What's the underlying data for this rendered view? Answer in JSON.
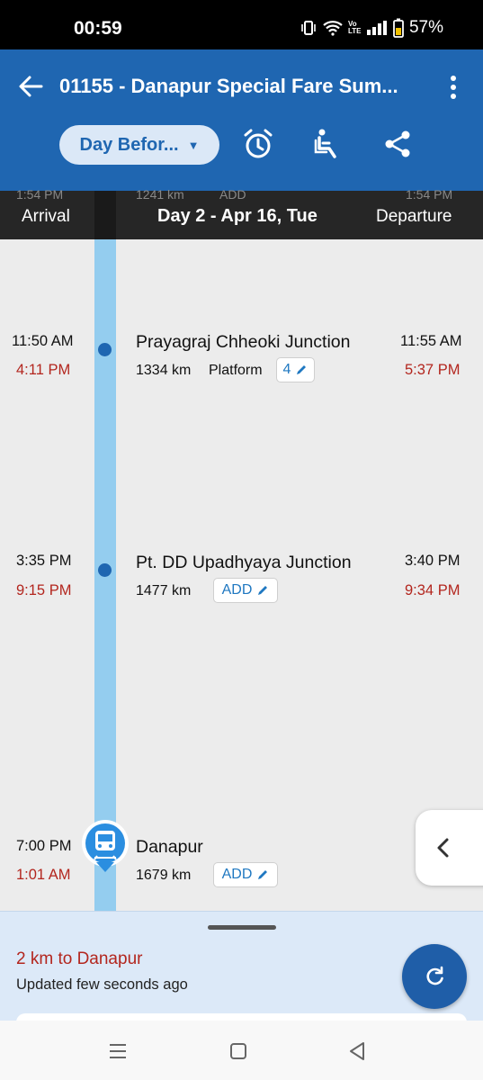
{
  "status_bar": {
    "time": "00:59",
    "battery": "57%",
    "network": "Vo LTE"
  },
  "app_bar": {
    "title": "01155 - Danapur Special Fare Sum...",
    "day_selector": "Day Befor...",
    "icons": [
      "back-arrow-icon",
      "more-vert-icon",
      "alarm-icon",
      "seat-icon",
      "share-icon"
    ]
  },
  "day_header": {
    "arrival_label": "Arrival",
    "day_label": "Day 2 - Apr 16, Tue",
    "departure_label": "Departure",
    "prev_arrival": "1:54 PM",
    "prev_km": "1241 km",
    "prev_add": "ADD",
    "prev_departure": "1:54 PM"
  },
  "stops": [
    {
      "name": "Prayagraj Chheoki Junction",
      "km": "1334 km",
      "platform_label": "Platform",
      "platform_value": "4",
      "sched_arrival": "11:50 AM",
      "actual_arrival": "4:11 PM",
      "sched_departure": "11:55 AM",
      "actual_departure": "5:37 PM"
    },
    {
      "name": "Pt. DD Upadhyaya Junction",
      "km": "1477 km",
      "platform_value": "ADD",
      "sched_arrival": "3:35 PM",
      "actual_arrival": "9:15 PM",
      "sched_departure": "3:40 PM",
      "actual_departure": "9:34 PM"
    },
    {
      "name": "Danapur",
      "km": "1679 km",
      "platform_value": "ADD",
      "sched_arrival": "7:00 PM",
      "actual_arrival": "1:01 AM"
    }
  ],
  "bottom_sheet": {
    "distance": "2 km to Danapur",
    "updated": "Updated few seconds ago"
  },
  "colors": {
    "primary": "#1f66b1",
    "delay_red": "#b3261e",
    "track": "#94cdef",
    "sheet_bg": "#dce9f8"
  }
}
